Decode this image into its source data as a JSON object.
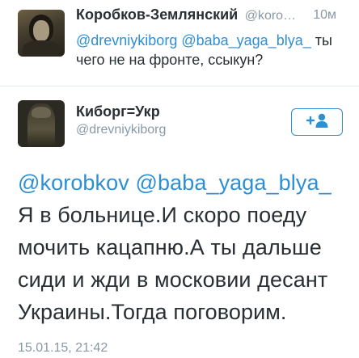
{
  "reply_tweet": {
    "author_name": "Коробков-Землянский",
    "author_handle": "@koro…",
    "time": "10м",
    "text_mentions": "@drevniykiborg @baba_yaga_blya_",
    "text_body": " ты чего не на фронте, ссыкун?"
  },
  "main_tweet": {
    "author_name": "Киборг=Укр",
    "author_handle": "@drevniykiborg",
    "follow_icon": "add-user-icon",
    "mention_1": "@korobkov",
    "mention_2": "@baba_yaga_blya_",
    "text_body": " Я в больнице.И скоро поеду мочить кацапню.А ты дальше сиди и жди в московии десант Украины.Тогда поговорим.",
    "timestamp": "15.01.15, 21:42"
  },
  "colors": {
    "link": "#2d8fd5",
    "muted": "#8899a6",
    "text": "#292f33",
    "divider": "#e1e8ed"
  }
}
